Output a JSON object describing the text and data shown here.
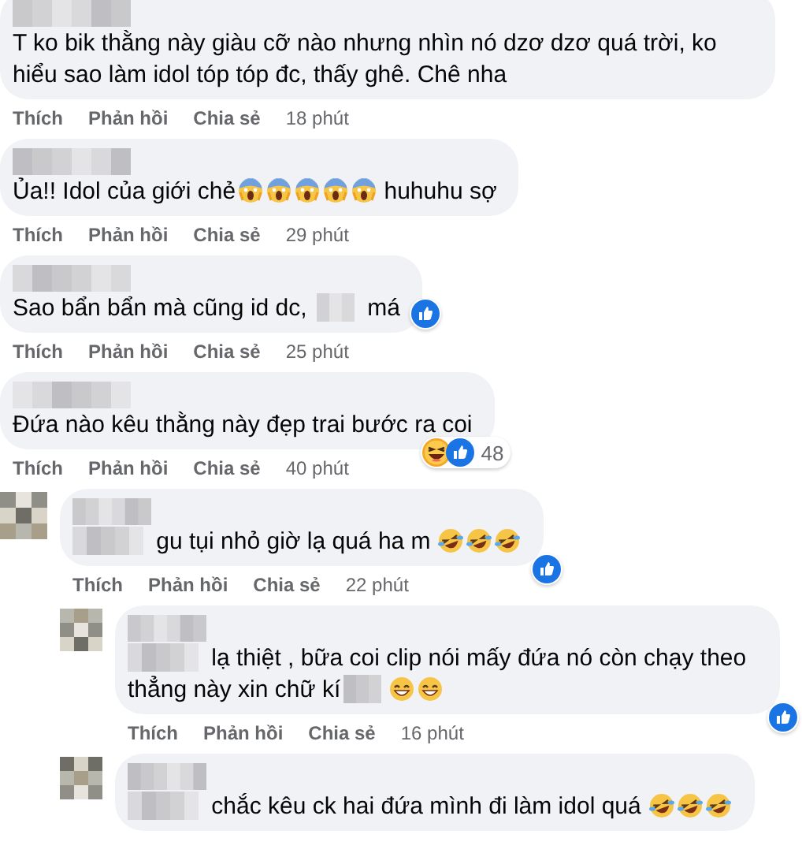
{
  "comments": [
    {
      "parts": [
        {
          "kind": "text",
          "text": "T ko bik thằng này giàu cỡ nào nhưng nhìn nó dzơ dzơ quá trời, ko hiểu sao làm idol tóp tóp đc, thấy ghê. Chê nha"
        }
      ],
      "actions": [
        "Thích",
        "Phản hồi",
        "Chia sẻ"
      ],
      "time": "18 phút"
    },
    {
      "parts": [
        {
          "kind": "text",
          "text": "Ủa!! Idol của giới chẻ"
        },
        {
          "kind": "scream"
        },
        {
          "kind": "scream"
        },
        {
          "kind": "scream"
        },
        {
          "kind": "scream"
        },
        {
          "kind": "scream"
        },
        {
          "kind": "text",
          "text": " huhuhu sợ"
        }
      ],
      "actions": [
        "Thích",
        "Phản hồi",
        "Chia sẻ"
      ],
      "time": "29 phút"
    },
    {
      "parts": [
        {
          "kind": "text",
          "text": "Sao bẩn bẩn mà cũng id dc, "
        },
        {
          "kind": "redacted"
        },
        {
          "kind": "text",
          "text": " má"
        }
      ],
      "reactions": [
        {
          "kind": "like"
        }
      ],
      "actions": [
        "Thích",
        "Phản hồi",
        "Chia sẻ"
      ],
      "time": "25 phút"
    },
    {
      "parts": [
        {
          "kind": "text",
          "text": "Đứa nào kêu thằng này đẹp trai bước ra coi"
        }
      ],
      "reactions": [
        {
          "kind": "haha"
        },
        {
          "kind": "like"
        }
      ],
      "reaction_count": "48",
      "actions": [
        "Thích",
        "Phản hồi",
        "Chia sẻ"
      ],
      "time": "40 phút",
      "children": [
        {
          "parts": [
            {
              "kind": "redacted"
            },
            {
              "kind": "text",
              "text": " gu tụi nhỏ giờ lạ quá ha m "
            },
            {
              "kind": "laugh"
            },
            {
              "kind": "laugh"
            },
            {
              "kind": "laugh"
            }
          ],
          "reactions": [
            {
              "kind": "like"
            }
          ],
          "actions": [
            "Thích",
            "Phản hồi",
            "Chia sẻ"
          ],
          "time": "22 phút",
          "children": [
            {
              "parts": [
                {
                  "kind": "redacted"
                },
                {
                  "kind": "text",
                  "text": " lạ thiệt , bữa coi clip nói mấy đứa nó còn chạy theo"
                },
                {
                  "kind": "text",
                  "text": "thẳng này xin chữ kí"
                },
                {
                  "kind": "redacted"
                },
                {
                  "kind": "grin"
                },
                {
                  "kind": "grin"
                }
              ],
              "reactions": [
                {
                  "kind": "like"
                }
              ],
              "actions": [
                "Thích",
                "Phản hồi",
                "Chia sẻ"
              ],
              "time": "16 phút"
            },
            {
              "parts": [
                {
                  "kind": "redacted"
                },
                {
                  "kind": "text",
                  "text": " chắc kêu ck hai đứa mình đi làm idol quá "
                },
                {
                  "kind": "laugh"
                },
                {
                  "kind": "laugh"
                },
                {
                  "kind": "laugh"
                }
              ]
            }
          ]
        }
      ]
    }
  ]
}
